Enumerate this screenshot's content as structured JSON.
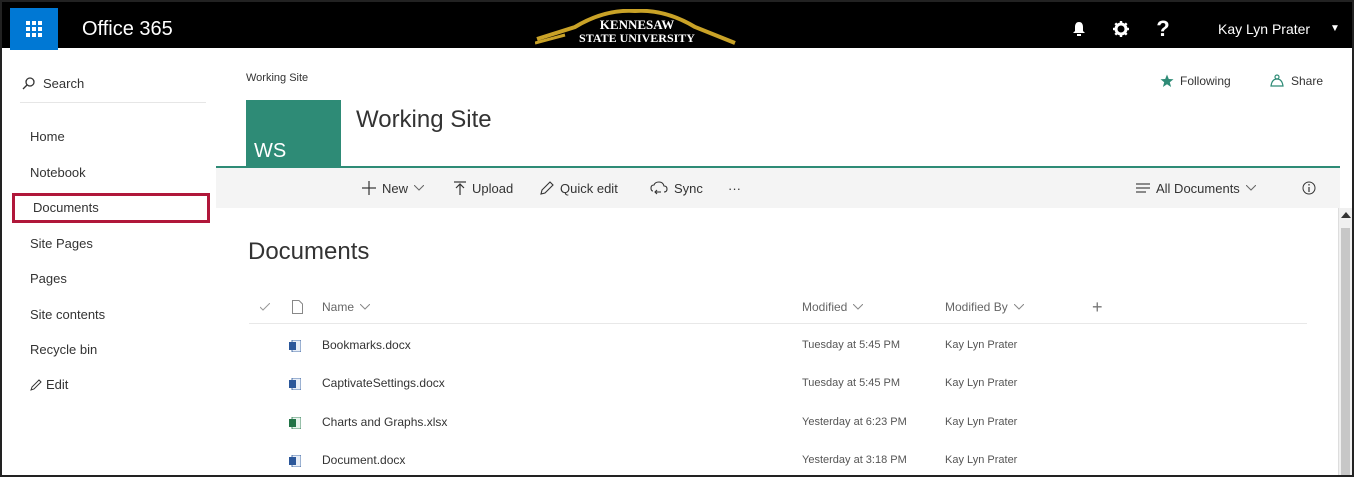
{
  "suitebar": {
    "app_title": "Office 365",
    "logo_text_top": "KENNESAW",
    "logo_text_bottom": "STATE UNIVERSITY",
    "user_name": "Kay Lyn Prater",
    "icons": [
      "waffle-icon",
      "bell-icon",
      "gear-icon",
      "help-icon",
      "chevron-down-icon"
    ],
    "help_glyph": "?"
  },
  "leftnav": {
    "search_label": "Search",
    "items": [
      {
        "label": "Home"
      },
      {
        "label": "Notebook"
      },
      {
        "label": "Documents",
        "active": true
      },
      {
        "label": "Site Pages"
      },
      {
        "label": "Pages"
      },
      {
        "label": "Site contents"
      },
      {
        "label": "Recycle bin"
      }
    ],
    "edit_label": "Edit"
  },
  "site": {
    "breadcrumb": "Working Site",
    "following_label": "Following",
    "share_label": "Share",
    "tile_initials": "WS",
    "title": "Working Site"
  },
  "commandbar": {
    "new_label": "New",
    "upload_label": "Upload",
    "quickedit_label": "Quick edit",
    "sync_label": "Sync",
    "more_label": "···",
    "view_label": "All Documents"
  },
  "library": {
    "heading": "Documents",
    "columns": {
      "name": "Name",
      "modified": "Modified",
      "modified_by": "Modified By",
      "add": "+"
    },
    "rows": [
      {
        "name": "Bookmarks.docx",
        "modified": "Tuesday at 5:45 PM",
        "modified_by": "Kay Lyn Prater",
        "icon": "word-file-icon"
      },
      {
        "name": "CaptivateSettings.docx",
        "modified": "Tuesday at 5:45 PM",
        "modified_by": "Kay Lyn Prater",
        "icon": "word-file-icon"
      },
      {
        "name": "Charts and Graphs.xlsx",
        "modified": "Yesterday at 6:23 PM",
        "modified_by": "Kay Lyn Prater",
        "icon": "excel-file-icon"
      },
      {
        "name": "Document.docx",
        "modified": "Yesterday at 3:18 PM",
        "modified_by": "Kay Lyn Prater",
        "icon": "word-file-icon"
      }
    ]
  },
  "colors": {
    "suitebar": "#000000",
    "waffle": "#0078d4",
    "site_accent": "#2e8b76",
    "active_nav_border": "#b0173a",
    "logo_gold": "#c9a227",
    "word_blue": "#2b579a",
    "excel_green": "#217346"
  }
}
